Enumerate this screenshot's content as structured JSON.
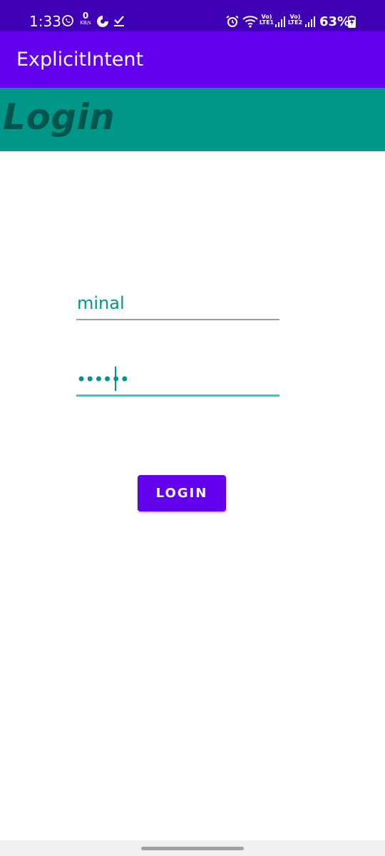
{
  "status_bar": {
    "time": "1:33",
    "net_speed_value": "0",
    "net_speed_unit": "KB/s",
    "sim1_label": "Vo)\nLTE1",
    "sim2_label": "Vo)\nLTE2",
    "sim1_top": "Vo)",
    "sim1_bottom": "LTE1",
    "sim2_top": "Vo)",
    "sim2_bottom": "LTE2",
    "battery_percent": "63%",
    "icons": [
      "whatsapp-icon",
      "data-speed",
      "vpn-icon",
      "download-done-icon",
      "alarm-icon",
      "wifi-icon",
      "signal-icon",
      "signal-icon",
      "battery-charging-icon"
    ],
    "background": "#3f00b5"
  },
  "app_bar": {
    "title": "ExplicitIntent",
    "background": "#6200ee"
  },
  "header": {
    "title": "Login",
    "background": "#009688",
    "text_color": "#00564d"
  },
  "form": {
    "username_value": "minal",
    "password_value": "••••••",
    "text_color": "#009688",
    "focused_underline_color": "#1fd3c1"
  },
  "login_button": {
    "label": "LOGIN",
    "background": "#6200ee"
  }
}
